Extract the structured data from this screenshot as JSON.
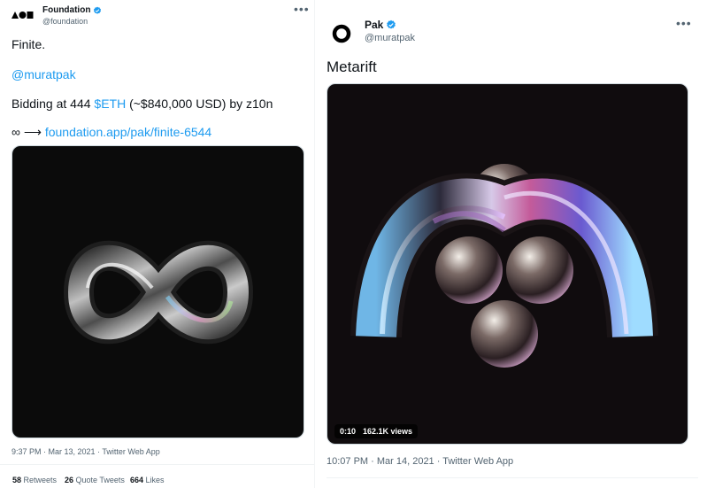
{
  "left_tweet": {
    "author_name": "Foundation",
    "author_handle": "@foundation",
    "line1": "Finite.",
    "mention": "@muratpak",
    "bid_prefix": "Bidding at 444 ",
    "bid_cashtag": "$ETH",
    "bid_suffix": " (~$840,000 USD) by z10n",
    "link_prefix": "∞ ⟶ ",
    "link_text": "foundation.app/pak/finite-6544",
    "timestamp": "9:37 PM · Mar 13, 2021 · Twitter Web App",
    "retweets_count": "58",
    "retweets_label": " Retweets",
    "quotes_count": "26",
    "quotes_label": " Quote Tweets",
    "likes_count": "664",
    "likes_label": " Likes"
  },
  "right_tweet": {
    "author_name": "Pak",
    "author_handle": "@muratpak",
    "text": "Metarift",
    "video_time": "0:10",
    "video_views": "162.1K views",
    "timestamp": "10:07 PM · Mar 14, 2021 · Twitter Web App"
  },
  "colors": {
    "link": "#1d9bf0",
    "verified": "#1d9bf0",
    "muted_text": "#536471",
    "media_background": "#0b0b0b"
  },
  "icons": [
    "foundation-logo",
    "verified-badge-icon",
    "more-options-icon",
    "pak-logo"
  ]
}
